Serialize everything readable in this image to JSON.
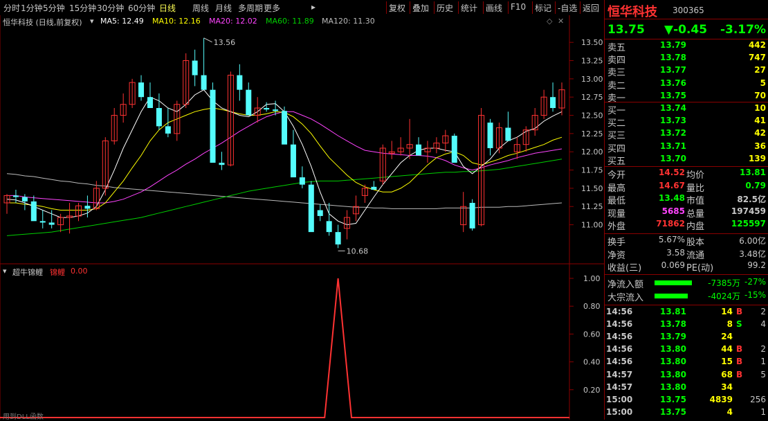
{
  "toolbar": {
    "periods": [
      "分时",
      "1分钟",
      "5分钟",
      "15分钟",
      "30分钟",
      "60分钟",
      "日线",
      "周线",
      "月线",
      "多周期",
      "更多"
    ],
    "active_period": "日线",
    "more_arrow": "▸",
    "right_buttons": [
      "复权",
      "叠加",
      "历史",
      "统计",
      "画线",
      "F10",
      "标记",
      "-自选",
      "返回"
    ]
  },
  "legend": {
    "title": "恒华科技 (日线,前复权)",
    "ma5": "MA5: 12.49",
    "ma10": "MA10: 12.16",
    "ma20": "MA20: 12.02",
    "ma60": "MA60: 11.89",
    "ma120": "MA120: 11.30"
  },
  "colors": {
    "up": "#ff3232",
    "down": "#54fcfc",
    "ma5": "#ffffff",
    "ma10": "#ffff00",
    "ma20": "#ff44ff",
    "ma60": "#00d000",
    "ma120": "#bbbbbb",
    "grid": "#8b0000",
    "lime": "#00ff00",
    "yellow": "#ffff00",
    "magenta": "#ff44ff"
  },
  "main_chart": {
    "price_axis": [
      "13.50",
      "13.25",
      "13.00",
      "12.75",
      "12.50",
      "12.25",
      "12.00",
      "11.75",
      "11.50",
      "11.25",
      "11.00"
    ],
    "high_label": "13.56",
    "low_label": "10.68",
    "ymin": 10.55,
    "ymax": 13.72
  },
  "chart_data": {
    "type": "candlestick",
    "ohlc": [
      [
        11.3,
        11.42,
        11.15,
        11.4
      ],
      [
        11.4,
        11.48,
        11.3,
        11.38
      ],
      [
        11.38,
        11.42,
        11.2,
        11.32
      ],
      [
        11.32,
        11.4,
        11.1,
        11.05
      ],
      [
        11.05,
        11.2,
        10.95,
        11.03
      ],
      [
        11.03,
        11.2,
        10.95,
        11.0
      ],
      [
        11.0,
        11.15,
        10.9,
        11.1
      ],
      [
        11.1,
        11.3,
        10.88,
        11.12
      ],
      [
        11.12,
        11.3,
        11.05,
        11.26
      ],
      [
        11.26,
        11.4,
        11.1,
        11.22
      ],
      [
        11.22,
        11.6,
        11.2,
        11.5
      ],
      [
        11.5,
        12.2,
        11.4,
        12.15
      ],
      [
        12.15,
        12.6,
        12.1,
        12.5
      ],
      [
        12.5,
        12.8,
        12.4,
        12.65
      ],
      [
        12.65,
        13.0,
        12.6,
        12.95
      ],
      [
        12.95,
        13.05,
        12.7,
        12.75
      ],
      [
        12.75,
        12.95,
        12.6,
        12.6
      ],
      [
        12.6,
        12.8,
        12.3,
        12.35
      ],
      [
        12.35,
        12.6,
        12.2,
        12.25
      ],
      [
        12.25,
        12.7,
        12.15,
        12.65
      ],
      [
        12.65,
        13.35,
        12.6,
        13.25
      ],
      [
        13.25,
        13.4,
        12.9,
        13.05
      ],
      [
        13.05,
        13.56,
        12.85,
        12.85
      ],
      [
        12.85,
        12.95,
        11.85,
        11.85
      ],
      [
        11.85,
        12.0,
        11.75,
        11.82
      ],
      [
        11.82,
        13.1,
        11.8,
        13.05
      ],
      [
        13.05,
        13.2,
        12.7,
        12.85
      ],
      [
        12.85,
        12.95,
        12.5,
        12.5
      ],
      [
        12.5,
        12.75,
        12.4,
        12.6
      ],
      [
        12.6,
        12.68,
        12.55,
        12.58
      ],
      [
        12.58,
        12.7,
        12.5,
        12.56
      ],
      [
        12.56,
        12.62,
        12.2,
        12.1
      ],
      [
        12.1,
        12.3,
        11.95,
        11.65
      ],
      [
        11.65,
        11.8,
        11.5,
        11.55
      ],
      [
        11.55,
        11.6,
        10.95,
        10.9
      ],
      [
        11.2,
        11.28,
        11.05,
        11.12
      ],
      [
        11.05,
        11.3,
        10.85,
        10.9
      ],
      [
        10.9,
        11.0,
        10.68,
        10.73
      ],
      [
        10.95,
        11.2,
        10.8,
        11.1
      ],
      [
        11.15,
        11.4,
        11.05,
        11.25
      ],
      [
        11.4,
        11.55,
        11.3,
        11.5
      ],
      [
        11.52,
        11.6,
        11.48,
        11.48
      ],
      [
        11.6,
        12.1,
        11.55,
        12.05
      ],
      [
        11.98,
        12.15,
        11.9,
        12.0
      ],
      [
        12.0,
        12.2,
        11.95,
        12.05
      ],
      [
        12.05,
        12.45,
        11.9,
        12.1
      ],
      [
        12.1,
        12.2,
        11.95,
        11.95
      ],
      [
        12.0,
        12.15,
        11.85,
        12.05
      ],
      [
        12.05,
        12.2,
        11.98,
        12.12
      ],
      [
        12.12,
        12.3,
        12.0,
        12.22
      ],
      [
        12.22,
        12.25,
        11.9,
        11.85
      ],
      [
        11.0,
        11.45,
        10.9,
        11.25
      ],
      [
        11.3,
        11.35,
        10.92,
        10.95
      ],
      [
        11.0,
        12.6,
        10.98,
        12.5
      ],
      [
        12.4,
        12.45,
        11.95,
        12.05
      ],
      [
        12.05,
        12.4,
        11.98,
        12.33
      ],
      [
        12.33,
        12.55,
        12.15,
        12.15
      ],
      [
        12.0,
        12.2,
        11.9,
        12.1
      ],
      [
        12.1,
        12.35,
        12.0,
        12.3
      ],
      [
        12.3,
        12.6,
        12.22,
        12.5
      ],
      [
        12.5,
        12.85,
        12.45,
        12.75
      ],
      [
        12.75,
        12.95,
        12.55,
        12.6
      ],
      [
        12.6,
        12.95,
        12.5,
        12.85
      ]
    ],
    "ma5": [
      11.35,
      11.34,
      11.3,
      11.25,
      11.2,
      11.15,
      11.1,
      11.1,
      11.12,
      11.16,
      11.25,
      11.48,
      11.75,
      12.05,
      12.3,
      12.55,
      12.75,
      12.7,
      12.6,
      12.55,
      12.65,
      12.78,
      12.85,
      12.7,
      12.6,
      12.55,
      12.5,
      12.48,
      12.55,
      12.65,
      12.66,
      12.55,
      12.35,
      12.1,
      11.8,
      11.45,
      11.15,
      11.05,
      11.0,
      11.02,
      11.2,
      11.38,
      11.55,
      11.7,
      11.85,
      11.95,
      12.02,
      12.05,
      12.05,
      12.02,
      12.0,
      11.8,
      11.7,
      11.8,
      11.9,
      12.05,
      12.15,
      12.2,
      12.28,
      12.32,
      12.42,
      12.49,
      12.55
    ],
    "ma10": [
      11.3,
      11.3,
      11.28,
      11.27,
      11.25,
      11.22,
      11.2,
      11.2,
      11.2,
      11.2,
      11.22,
      11.3,
      11.45,
      11.6,
      11.78,
      11.95,
      12.15,
      12.3,
      12.4,
      12.45,
      12.5,
      12.55,
      12.58,
      12.6,
      12.58,
      12.55,
      12.52,
      12.5,
      12.5,
      12.52,
      12.55,
      12.54,
      12.48,
      12.38,
      12.25,
      12.08,
      11.92,
      11.8,
      11.68,
      11.58,
      11.52,
      11.48,
      11.45,
      11.45,
      11.5,
      11.58,
      11.7,
      11.82,
      11.92,
      11.97,
      12.0,
      11.95,
      11.85,
      11.82,
      11.86,
      11.9,
      11.95,
      11.98,
      12.02,
      12.06,
      12.1,
      12.16,
      12.2
    ],
    "ma20": [
      11.4,
      11.4,
      11.38,
      11.37,
      11.36,
      11.35,
      11.34,
      11.33,
      11.32,
      11.31,
      11.3,
      11.3,
      11.32,
      11.35,
      11.4,
      11.45,
      11.52,
      11.6,
      11.68,
      11.75,
      11.83,
      11.9,
      11.98,
      12.05,
      12.12,
      12.2,
      12.28,
      12.35,
      12.42,
      12.48,
      12.52,
      12.55,
      12.55,
      12.5,
      12.45,
      12.38,
      12.3,
      12.22,
      12.15,
      12.08,
      12.02,
      12.0,
      11.98,
      11.97,
      11.96,
      11.95,
      11.95,
      11.94,
      11.92,
      11.88,
      11.82,
      11.78,
      11.75,
      11.78,
      11.82,
      11.85,
      11.88,
      11.92,
      11.95,
      11.98,
      12.0,
      12.02,
      12.04
    ],
    "ma60": [
      10.85,
      10.86,
      10.87,
      10.88,
      10.89,
      10.9,
      10.92,
      10.94,
      10.96,
      10.98,
      11.0,
      11.02,
      11.04,
      11.06,
      11.08,
      11.1,
      11.13,
      11.16,
      11.19,
      11.22,
      11.25,
      11.28,
      11.31,
      11.34,
      11.37,
      11.4,
      11.43,
      11.46,
      11.48,
      11.5,
      11.52,
      11.54,
      11.56,
      11.58,
      11.59,
      11.6,
      11.6,
      11.6,
      11.61,
      11.62,
      11.63,
      11.64,
      11.65,
      11.66,
      11.67,
      11.68,
      11.69,
      11.7,
      11.71,
      11.72,
      11.72,
      11.73,
      11.73,
      11.74,
      11.75,
      11.76,
      11.78,
      11.8,
      11.82,
      11.84,
      11.86,
      11.88,
      11.9
    ],
    "ma120": [
      11.7,
      11.69,
      11.67,
      11.66,
      11.64,
      11.62,
      11.6,
      11.59,
      11.57,
      11.56,
      11.54,
      11.53,
      11.51,
      11.5,
      11.49,
      11.48,
      11.47,
      11.46,
      11.45,
      11.44,
      11.43,
      11.42,
      11.41,
      11.4,
      11.39,
      11.38,
      11.37,
      11.36,
      11.35,
      11.34,
      11.33,
      11.32,
      11.31,
      11.3,
      11.29,
      11.28,
      11.27,
      11.26,
      11.25,
      11.24,
      11.24,
      11.23,
      11.23,
      11.22,
      11.22,
      11.22,
      11.22,
      11.22,
      11.22,
      11.23,
      11.23,
      11.23,
      11.23,
      11.24,
      11.24,
      11.24,
      11.25,
      11.25,
      11.26,
      11.27,
      11.28,
      11.29,
      11.3
    ],
    "indicator": {
      "name": "超牛锦鲤",
      "series_name": "锦鲤",
      "value_label": "0.00",
      "axis": [
        "1.00",
        "0.80",
        "0.60",
        "0.40",
        "0.20"
      ],
      "spike_index": 37,
      "spike_value": 1.0
    }
  },
  "footer_note": "用到DLL函数",
  "quote": {
    "name": "恒华科技",
    "code": "300365",
    "price": "13.75",
    "change": "▼-0.45",
    "pct": "-3.17%",
    "asks": [
      [
        "卖五",
        "13.79",
        "442"
      ],
      [
        "卖四",
        "13.78",
        "747"
      ],
      [
        "卖三",
        "13.77",
        "27"
      ],
      [
        "卖二",
        "13.76",
        "5"
      ],
      [
        "卖一",
        "13.75",
        "70"
      ]
    ],
    "bids": [
      [
        "买一",
        "13.74",
        "10"
      ],
      [
        "买二",
        "13.73",
        "41"
      ],
      [
        "买三",
        "13.72",
        "42"
      ],
      [
        "买四",
        "13.71",
        "36"
      ],
      [
        "买五",
        "13.70",
        "139"
      ]
    ],
    "stats_left": [
      [
        "今开",
        "14.52"
      ],
      [
        "最高",
        "14.67"
      ],
      [
        "最低",
        "13.48"
      ],
      [
        "现量",
        "5685"
      ],
      [
        "外盘",
        "71862"
      ]
    ],
    "stats_right": [
      [
        "均价",
        "13.81"
      ],
      [
        "量比",
        "0.79"
      ],
      [
        "市值",
        "82.5亿"
      ],
      [
        "总量",
        "197459"
      ],
      [
        "内盘",
        "125597"
      ]
    ],
    "ratios": [
      [
        "换手",
        "5.67%",
        "股本",
        "6.00亿"
      ],
      [
        "净资",
        "3.58",
        "流通",
        "3.48亿"
      ],
      [
        "收益(三)",
        "0.069",
        "PE(动)",
        "99.2"
      ]
    ],
    "flows": [
      [
        "净流入额",
        "-7385万",
        "-27%"
      ],
      [
        "大宗流入",
        "-4024万",
        "-15%"
      ]
    ],
    "ticks": [
      [
        "14:56",
        "13.81",
        "14",
        "B",
        "2"
      ],
      [
        "14:56",
        "13.78",
        "8",
        "S",
        "4"
      ],
      [
        "14:56",
        "13.79",
        "24",
        "",
        ""
      ],
      [
        "14:56",
        "13.80",
        "44",
        "B",
        "2"
      ],
      [
        "14:56",
        "13.80",
        "15",
        "B",
        "1"
      ],
      [
        "14:57",
        "13.80",
        "68",
        "B",
        "5"
      ],
      [
        "14:57",
        "13.80",
        "34",
        "",
        ""
      ],
      [
        "15:00",
        "13.75",
        "4839",
        "",
        "256"
      ],
      [
        "15:00",
        "13.75",
        "4",
        "",
        "1"
      ]
    ]
  },
  "watermark": {
    "text": "后股网",
    "url": "www.201082.com"
  }
}
